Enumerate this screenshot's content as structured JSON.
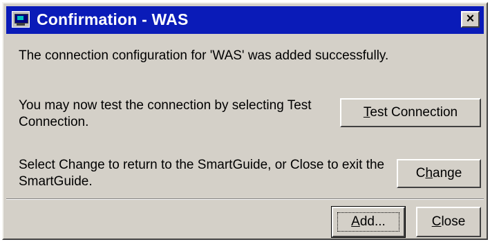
{
  "window": {
    "title": "Confirmation - WAS",
    "close_glyph": "×"
  },
  "messages": {
    "added": "The connection configuration for 'WAS' was added successfully.",
    "test_hint": "You may now test the connection by selecting Test Connection.",
    "change_hint": "Select Change to return to the SmartGuide, or Close to exit the SmartGuide."
  },
  "buttons": {
    "test_connection": {
      "mnemonic": "T",
      "rest": "est Connection"
    },
    "change": {
      "pre": "C",
      "mnemonic": "h",
      "rest": "ange"
    },
    "add": {
      "mnemonic": "A",
      "rest": "dd..."
    },
    "close": {
      "mnemonic": "C",
      "rest": "lose"
    }
  },
  "colors": {
    "titlebar": "#0a1bb8",
    "face": "#d4d0c8"
  },
  "icons": {
    "app": "db2-computer-icon",
    "close": "close-icon"
  }
}
